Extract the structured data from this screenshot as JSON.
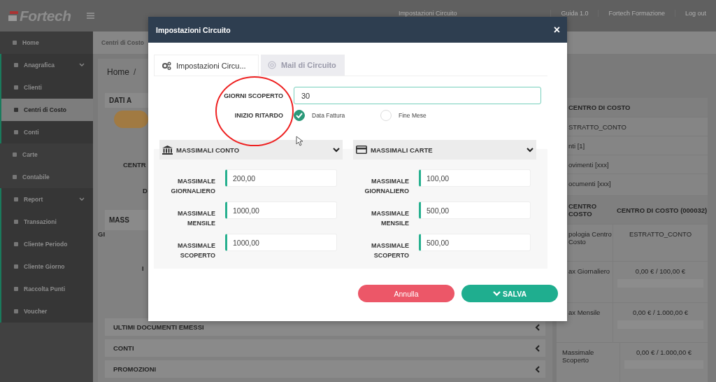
{
  "header": {
    "logo": "Fortech",
    "links": [
      "Impostazioni Circuito",
      "Guida 1.0",
      "Fortech Formazione",
      "Log out"
    ]
  },
  "sidebar": {
    "items": [
      {
        "label": "Home",
        "selected": false
      },
      {
        "label": "Anagrafica",
        "selected": false,
        "expanded": true,
        "children": [
          {
            "label": "Clienti",
            "selected": false
          },
          {
            "label": "Centri di Costo",
            "selected": true
          },
          {
            "label": "Conti",
            "selected": false
          }
        ]
      },
      {
        "label": "Carte",
        "selected": false
      },
      {
        "label": "Contabile",
        "selected": false
      },
      {
        "label": "Report",
        "selected": false,
        "expanded": true,
        "children": [
          {
            "label": "Transazioni",
            "selected": false
          },
          {
            "label": "Cliente Periodo",
            "selected": false
          },
          {
            "label": "Cliente Giorno",
            "selected": false
          },
          {
            "label": "Raccolta Punti",
            "selected": false
          },
          {
            "label": "Voucher",
            "selected": false
          }
        ]
      }
    ]
  },
  "page": {
    "title": "Centri di Costo",
    "breadcrumb": "Home",
    "separator": "/",
    "dati_header": "DATI A",
    "fields_1": [
      "CENTR",
      "D"
    ],
    "massimali_header": "MASS",
    "fields_2": [
      "GI",
      "I"
    ],
    "sections": [
      "ULTIMI DOCUMENTI EMESSI",
      "CONTI",
      "PROMOZIONI"
    ]
  },
  "summary": {
    "title": "CENTRO DI COSTO",
    "items": [
      "STRATTO_CONTO",
      "nti [1]",
      "ovimenti [xxx]",
      "ocumenti [xxx]"
    ],
    "columns": [
      "CENTRO COSTO",
      "CENTRO DI COSTO (000032)"
    ],
    "rows": [
      {
        "label": "pologia Centro Costo",
        "value": "ESTRATTO_CONTO"
      },
      {
        "label": "ax Giornaliero",
        "value": "0,00 € / 100,00 €",
        "level": 0
      },
      {
        "label": "ax Mensile",
        "value": "0,00 € / 1.000,00 €",
        "level": 0
      },
      {
        "label": "Massimale Scoperto",
        "value": "0,00 € / 1.000,00 €",
        "level": 0
      }
    ]
  },
  "modal": {
    "title": "Impostazioni Circuito",
    "close": "×",
    "tabs": [
      {
        "label": "Impostazioni Circu...",
        "selected": true
      },
      {
        "label": "Mail di Circuito",
        "selected": false
      }
    ],
    "giorni": {
      "label": "GIORNI SCOPERTO",
      "value": "30"
    },
    "ritardo": {
      "label": "INIZIO RITARDO",
      "options": [
        {
          "label": "Data Fattura",
          "selected": true
        },
        {
          "label": "Fine Mese",
          "selected": false
        }
      ]
    },
    "panels": [
      {
        "title": "MASSIMALI CONTO",
        "expanded": true,
        "fields": [
          {
            "label": "MASSIMALE GIORNALIERO",
            "value": "200,00"
          },
          {
            "label": "MASSIMALE MENSILE",
            "value": "1000,00"
          },
          {
            "label": "MASSIMALE SCOPERTO",
            "value": "1000,00"
          }
        ]
      },
      {
        "title": "MASSIMALI CARTE",
        "expanded": true,
        "fields": [
          {
            "label": "MASSIMALE GIORNALIERO",
            "value": "100,00"
          },
          {
            "label": "MASSIMALE MENSILE",
            "value": "500,00"
          },
          {
            "label": "MASSIMALE SCOPERTO",
            "value": "500,00"
          }
        ]
      }
    ],
    "buttons": [
      {
        "label": "Annulla",
        "kind": "cancel"
      },
      {
        "label": "SALVA",
        "kind": "save"
      }
    ]
  }
}
